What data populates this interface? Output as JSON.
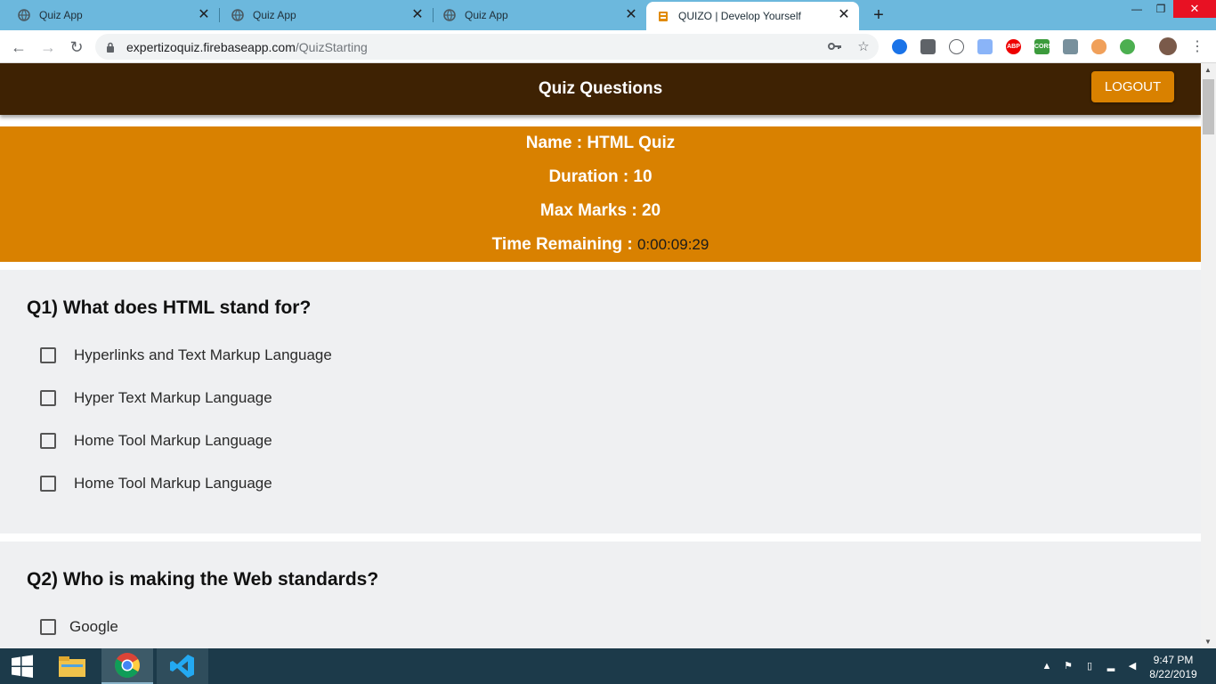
{
  "browser": {
    "tabs": [
      {
        "title": "Quiz App",
        "icon": "globe-icon"
      },
      {
        "title": "Quiz App",
        "icon": "globe-icon"
      },
      {
        "title": "Quiz App",
        "icon": "globe-icon"
      },
      {
        "title": "QUIZO | Develop Yourself",
        "icon": "quizo-favicon",
        "active": true
      }
    ],
    "close_glyph": "✕",
    "new_tab_glyph": "+",
    "url_domain": "expertizoquiz.firebaseapp.com",
    "url_path": "/QuizStarting",
    "window_controls": {
      "minimize": "—",
      "restore": "❐",
      "close": "✕"
    },
    "nav": {
      "back": "←",
      "forward": "→",
      "reload": "↻"
    },
    "extensions": [
      "ABP",
      "CORS"
    ]
  },
  "app": {
    "header_title": "Quiz Questions",
    "logout_label": "LOGOUT",
    "colors": {
      "header_bg": "#3e2203",
      "accent": "#d98100",
      "card_bg": "#eff0f2"
    }
  },
  "quiz_info": {
    "name_label": "Name : HTML Quiz",
    "duration_label": "Duration : 10",
    "max_marks_label": "Max Marks : 20",
    "time_remaining_label": "Time Remaining :",
    "time_remaining_value": "0:00:09:29"
  },
  "questions": [
    {
      "title": "Q1) What does HTML stand for?",
      "options": [
        "Hyperlinks and Text Markup Language",
        "Hyper Text Markup Language",
        "Home Tool Markup Language",
        "Home Tool Markup Language"
      ]
    },
    {
      "title": "Q2) Who is making the Web standards?",
      "options": [
        "Google"
      ]
    }
  ],
  "taskbar": {
    "apps": [
      "windows-start-icon",
      "file-explorer-icon",
      "chrome-icon",
      "vscode-icon"
    ],
    "time": "9:47 PM",
    "date": "8/22/2019"
  }
}
